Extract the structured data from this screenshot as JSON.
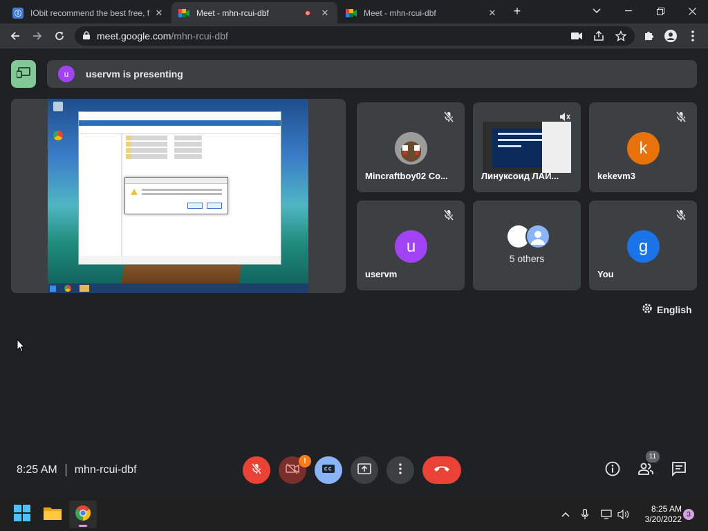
{
  "browser": {
    "tabs": [
      {
        "title": "IObit recommend the best free, f",
        "favicon_color": "#3d7bd6",
        "active": false
      },
      {
        "title": "Meet - mhn-rcui-dbf",
        "favicon_color": "#00832d",
        "active": true,
        "recording": true
      },
      {
        "title": "Meet - mhn-rcui-dbf",
        "favicon_color": "#00832d",
        "active": false
      }
    ],
    "new_tab_label": "+",
    "url_host": "meet.google.com",
    "url_path": "/mhn-rcui-dbf"
  },
  "presenting": {
    "avatar_letter": "u",
    "text": "uservm is presenting",
    "avatar_color": "#a142f4",
    "icon_bg": "#81c995"
  },
  "participants": [
    {
      "name": "Mincraftboy02 Co...",
      "type": "photo",
      "muted": true
    },
    {
      "name": "Линуксоид ЛАЙ...",
      "type": "screen",
      "muted": true
    },
    {
      "name": "kekevm3",
      "type": "letter",
      "letter": "k",
      "color": "#e8710a",
      "muted": true
    },
    {
      "name": "uservm",
      "type": "letter",
      "letter": "u",
      "color": "#a142f4",
      "muted": true
    },
    {
      "name": "",
      "type": "others",
      "others_label": "5 others",
      "muted": false
    },
    {
      "name": "You",
      "type": "letter",
      "letter": "g",
      "color": "#1a73e8",
      "muted": true
    }
  ],
  "captions_language": "English",
  "meeting": {
    "time": "8:25 AM",
    "code": "mhn-rcui-dbf",
    "people_count": "11",
    "camera_warning": "!"
  },
  "taskbar": {
    "time": "8:25 AM",
    "date": "3/20/2022",
    "notifications": "3"
  }
}
